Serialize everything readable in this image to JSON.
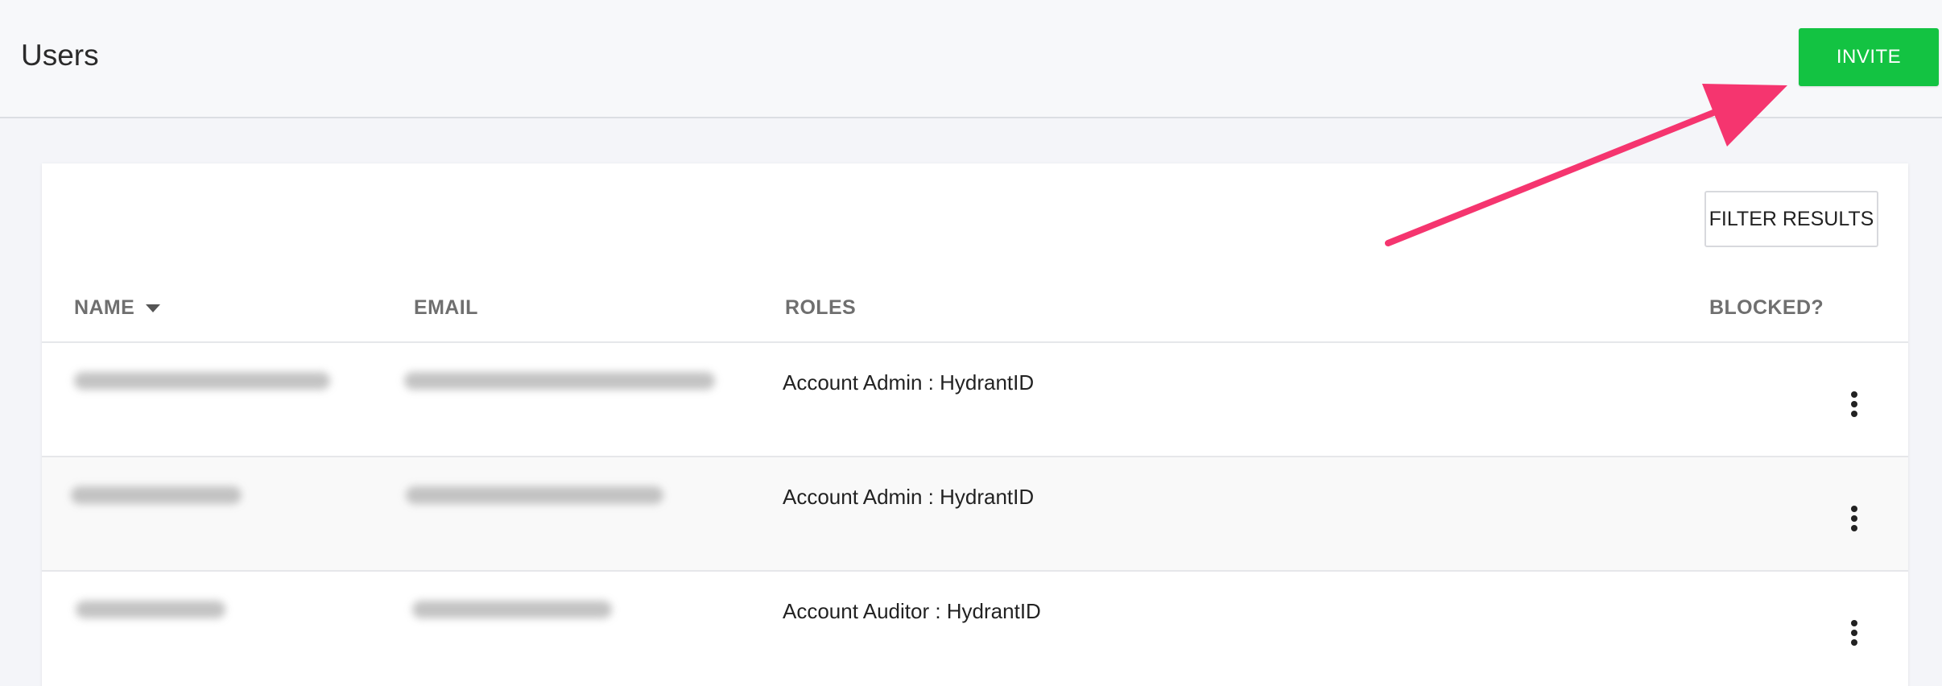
{
  "header": {
    "title": "Users",
    "invite_label": "INVITE"
  },
  "toolbar": {
    "filter_label": "FILTER RESULTS"
  },
  "table": {
    "columns": [
      "NAME",
      "EMAIL",
      "ROLES",
      "BLOCKED?"
    ],
    "sorted_column": "NAME",
    "sort_direction": "descending",
    "rows": [
      {
        "name": "",
        "email": "",
        "role": "Account Admin : HydrantID",
        "name_redacted": true,
        "email_redacted": true
      },
      {
        "name": "",
        "email": "",
        "role": "Account Admin : HydrantID",
        "name_redacted": true,
        "email_redacted": true
      },
      {
        "name": "",
        "email": "",
        "role": "Account Auditor : HydrantID",
        "name_redacted": true,
        "email_redacted": true
      }
    ]
  },
  "icons": {
    "sort": "caret-down-icon",
    "row_menu": "kebab-menu-icon",
    "annotation": "arrow-annotation"
  },
  "colors": {
    "invite_button": "#13c342",
    "annotation_arrow": "#f5356f",
    "header_bg": "#f7f8fa",
    "page_bg": "#f4f5f9"
  }
}
